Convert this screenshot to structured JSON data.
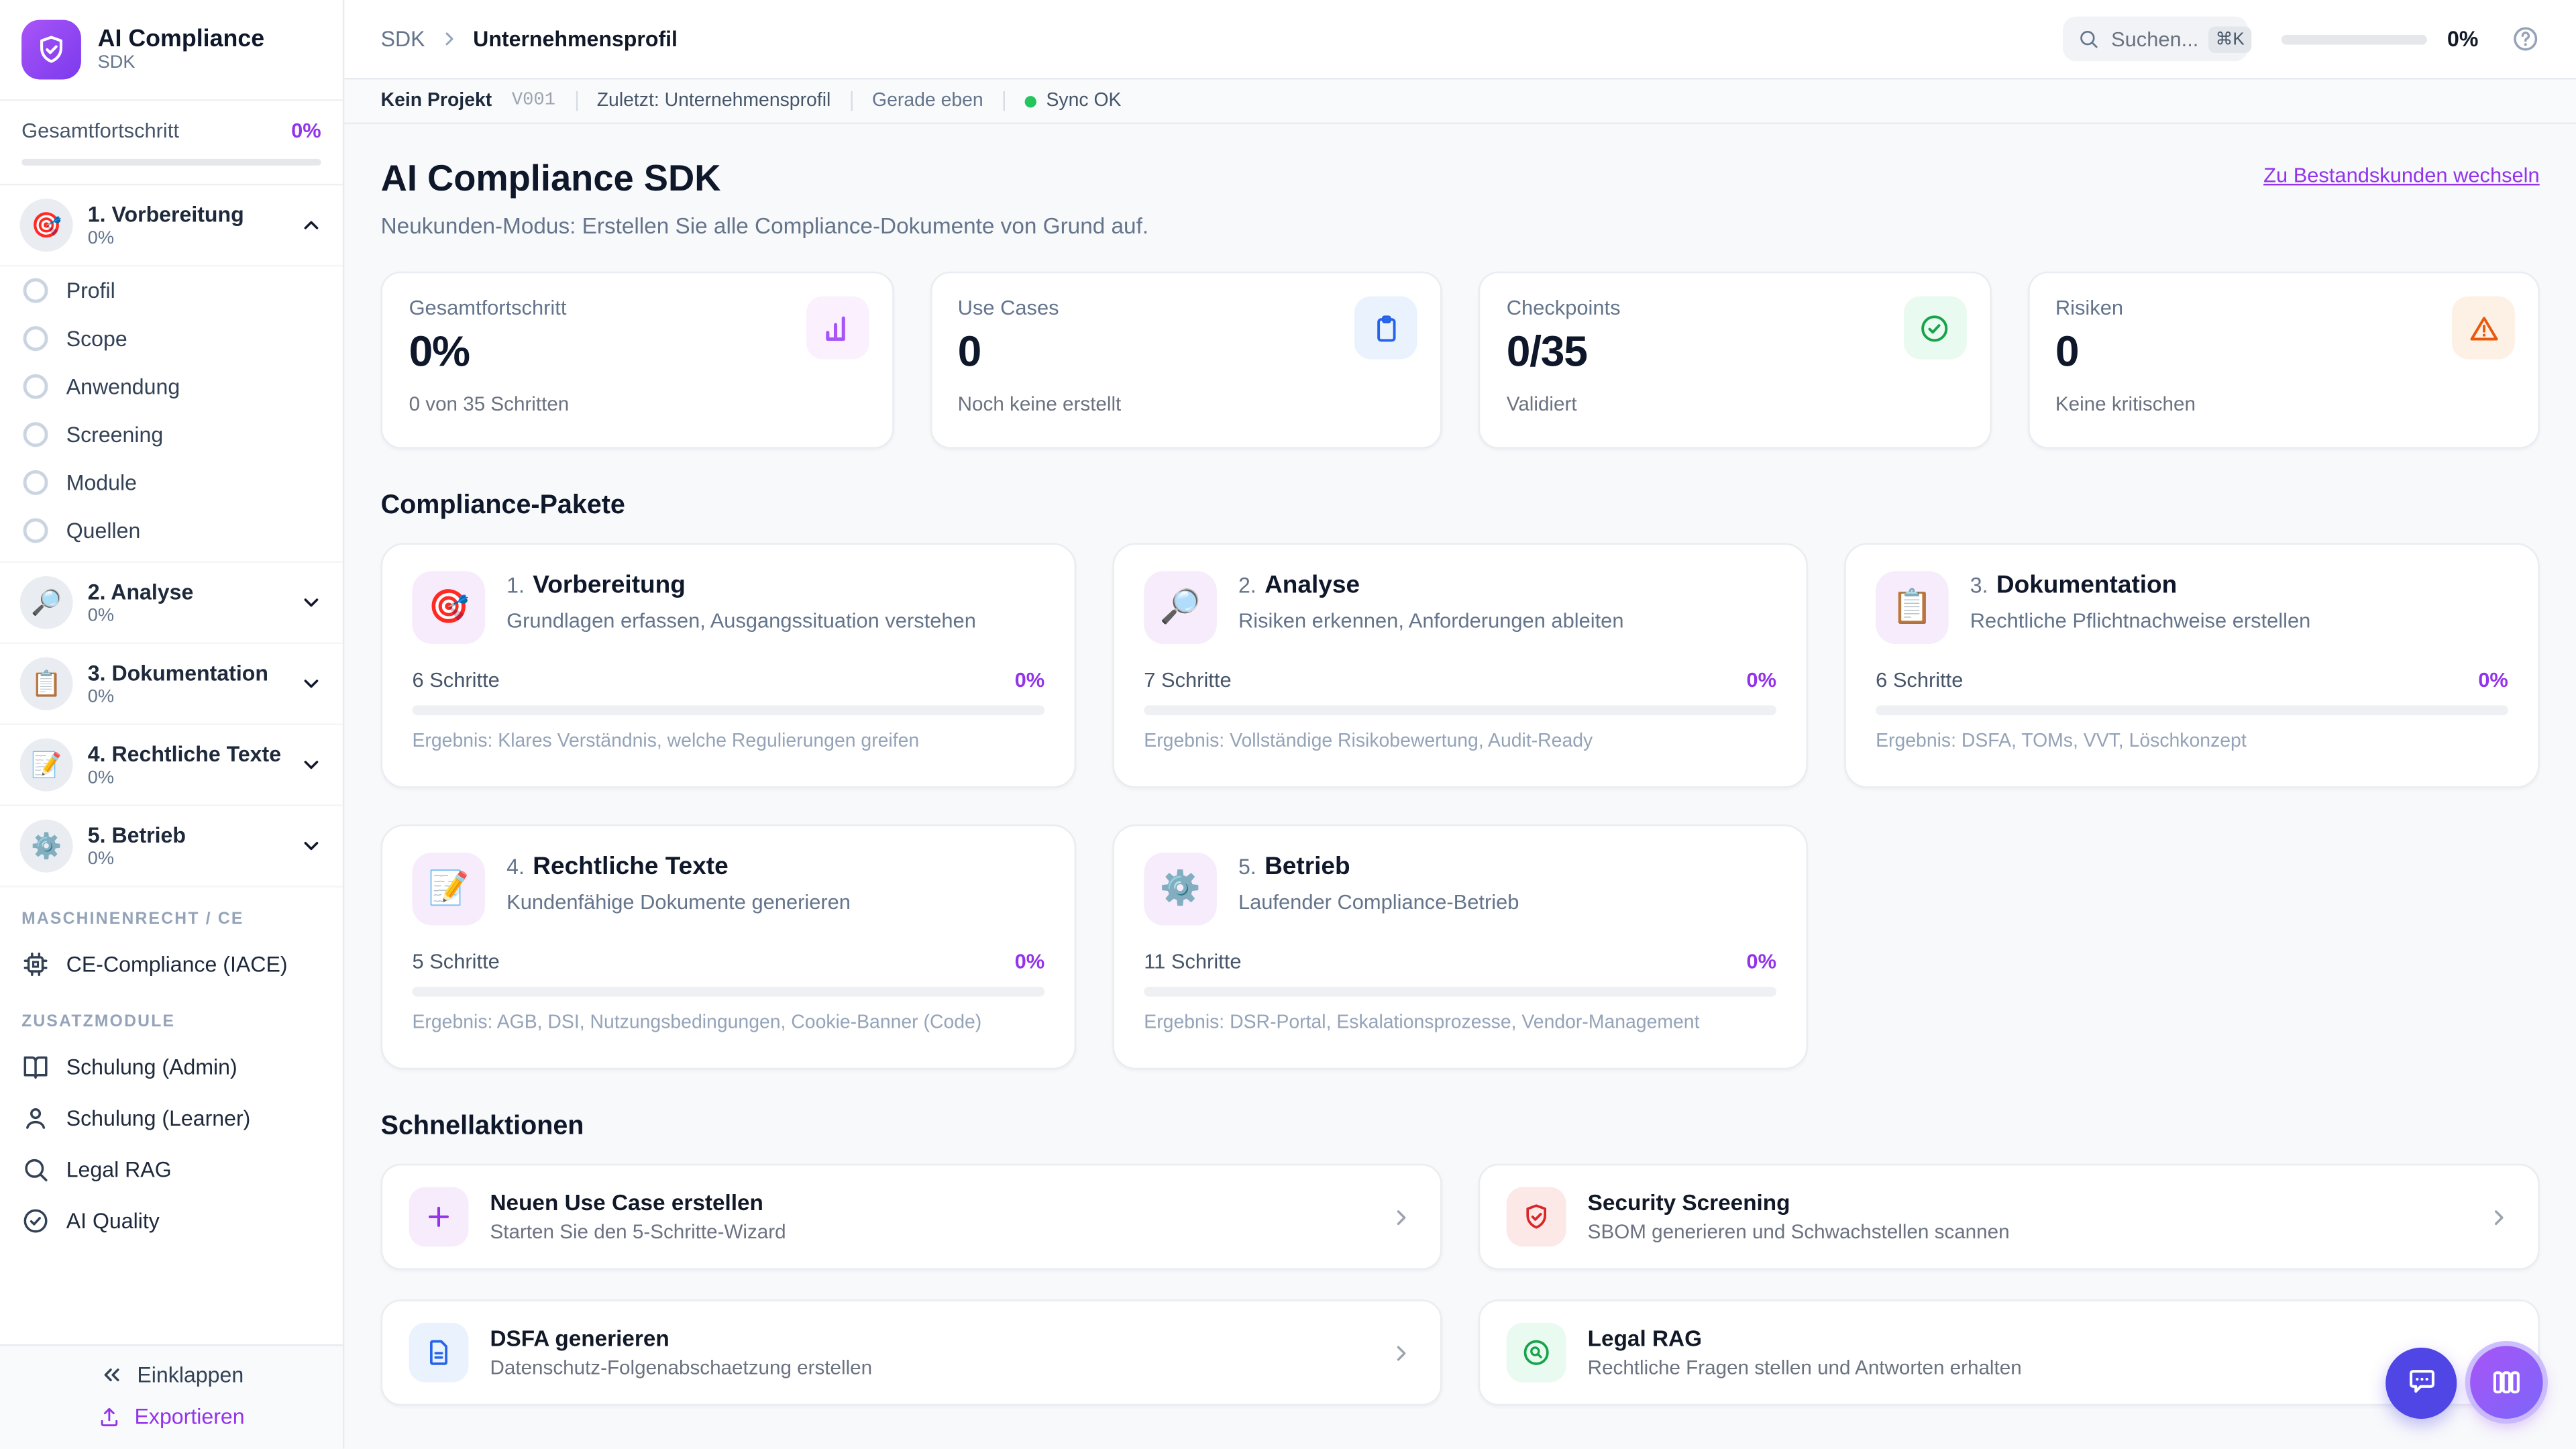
{
  "theme": {
    "accent": "#9333ea",
    "indigo": "#4f46e5",
    "green": "#22c55e",
    "red": "#dc2626",
    "blue": "#2563eb",
    "orange": "#ea580c"
  },
  "app": {
    "name": "AI Compliance",
    "subtitle": "SDK"
  },
  "sidebar": {
    "progress_label": "Gesamtfortschritt",
    "progress_value": "0%",
    "packages": [
      {
        "icon": "🎯",
        "label": "1. Vorbereitung",
        "percent": "0%"
      },
      {
        "icon": "🔎",
        "label": "2. Analyse",
        "percent": "0%"
      },
      {
        "icon": "📋",
        "label": "3. Dokumentation",
        "percent": "0%"
      },
      {
        "icon": "📝",
        "label": "4. Rechtliche Texte",
        "percent": "0%"
      },
      {
        "icon": "⚙️",
        "label": "5. Betrieb",
        "percent": "0%"
      }
    ],
    "subitems": [
      "Profil",
      "Scope",
      "Anwendung",
      "Screening",
      "Module",
      "Quellen"
    ],
    "section1_title": "MASCHINENRECHT / CE",
    "section1_item": "CE-Compliance (IACE)",
    "section2_title": "ZUSATZMODULE",
    "modules": [
      "Schulung (Admin)",
      "Schulung (Learner)",
      "Legal RAG",
      "AI Quality"
    ],
    "collapse_label": "Einklappen",
    "export_label": "Exportieren"
  },
  "header": {
    "breadcrumb_root": "SDK",
    "breadcrumb_current": "Unternehmensprofil",
    "search_placeholder": "Suchen...",
    "search_kbd": "⌘K",
    "progress_value": "0%"
  },
  "statusbar": {
    "project": "Kein Projekt",
    "version": "V001",
    "last": "Zuletzt: Unternehmensprofil",
    "time": "Gerade eben",
    "sync": "Sync OK"
  },
  "page": {
    "title": "AI Compliance SDK",
    "subtitle": "Neukunden-Modus: Erstellen Sie alle Compliance-Dokumente von Grund auf.",
    "switch_link": "Zu Bestandskunden wechseln"
  },
  "stats": [
    {
      "label": "Gesamtfortschritt",
      "value": "0%",
      "caption": "0 von 35 Schritten",
      "icon": "bar-chart-icon",
      "color": "#a855f7"
    },
    {
      "label": "Use Cases",
      "value": "0",
      "caption": "Noch keine erstellt",
      "icon": "clipboard-icon",
      "color": "#2563eb"
    },
    {
      "label": "Checkpoints",
      "value": "0/35",
      "caption": "Validiert",
      "icon": "check-circle-icon",
      "color": "#16a34a"
    },
    {
      "label": "Risiken",
      "value": "0",
      "caption": "Keine kritischen",
      "icon": "warning-triangle-icon",
      "color": "#ea580c"
    }
  ],
  "packages_section": {
    "title": "Compliance-Pakete",
    "cards": [
      {
        "num": "1.",
        "title": "Vorbereitung",
        "icon": "🎯",
        "desc": "Grundlagen erfassen, Ausgangssituation verstehen",
        "steps": "6 Schritte",
        "percent": "0%",
        "result": "Ergebnis: Klares Verständnis, welche Regulierungen greifen"
      },
      {
        "num": "2.",
        "title": "Analyse",
        "icon": "🔎",
        "desc": "Risiken erkennen, Anforderungen ableiten",
        "steps": "7 Schritte",
        "percent": "0%",
        "result": "Ergebnis: Vollständige Risikobewertung, Audit-Ready"
      },
      {
        "num": "3.",
        "title": "Dokumentation",
        "icon": "📋",
        "desc": "Rechtliche Pflichtnachweise erstellen",
        "steps": "6 Schritte",
        "percent": "0%",
        "result": "Ergebnis: DSFA, TOMs, VVT, Löschkonzept"
      },
      {
        "num": "4.",
        "title": "Rechtliche Texte",
        "icon": "📝",
        "desc": "Kundenfähige Dokumente generieren",
        "steps": "5 Schritte",
        "percent": "0%",
        "result": "Ergebnis: AGB, DSI, Nutzungsbedingungen, Cookie-Banner (Code)"
      },
      {
        "num": "5.",
        "title": "Betrieb",
        "icon": "⚙️",
        "desc": "Laufender Compliance-Betrieb",
        "steps": "11 Schritte",
        "percent": "0%",
        "result": "Ergebnis: DSR-Portal, Eskalationsprozesse, Vendor-Management"
      }
    ]
  },
  "quick_actions": {
    "title": "Schnellaktionen",
    "items": [
      {
        "title": "Neuen Use Case erstellen",
        "subtitle": "Starten Sie den 5-Schritte-Wizard",
        "icon": "plus-icon"
      },
      {
        "title": "Security Screening",
        "subtitle": "SBOM generieren und Schwachstellen scannen",
        "icon": "shield-check-icon"
      },
      {
        "title": "DSFA generieren",
        "subtitle": "Datenschutz-Folgenabschaetzung erstellen",
        "icon": "document-icon"
      },
      {
        "title": "Legal RAG",
        "subtitle": "Rechtliche Fragen stellen und Antworten erhalten",
        "icon": "search-circle-icon"
      }
    ]
  }
}
